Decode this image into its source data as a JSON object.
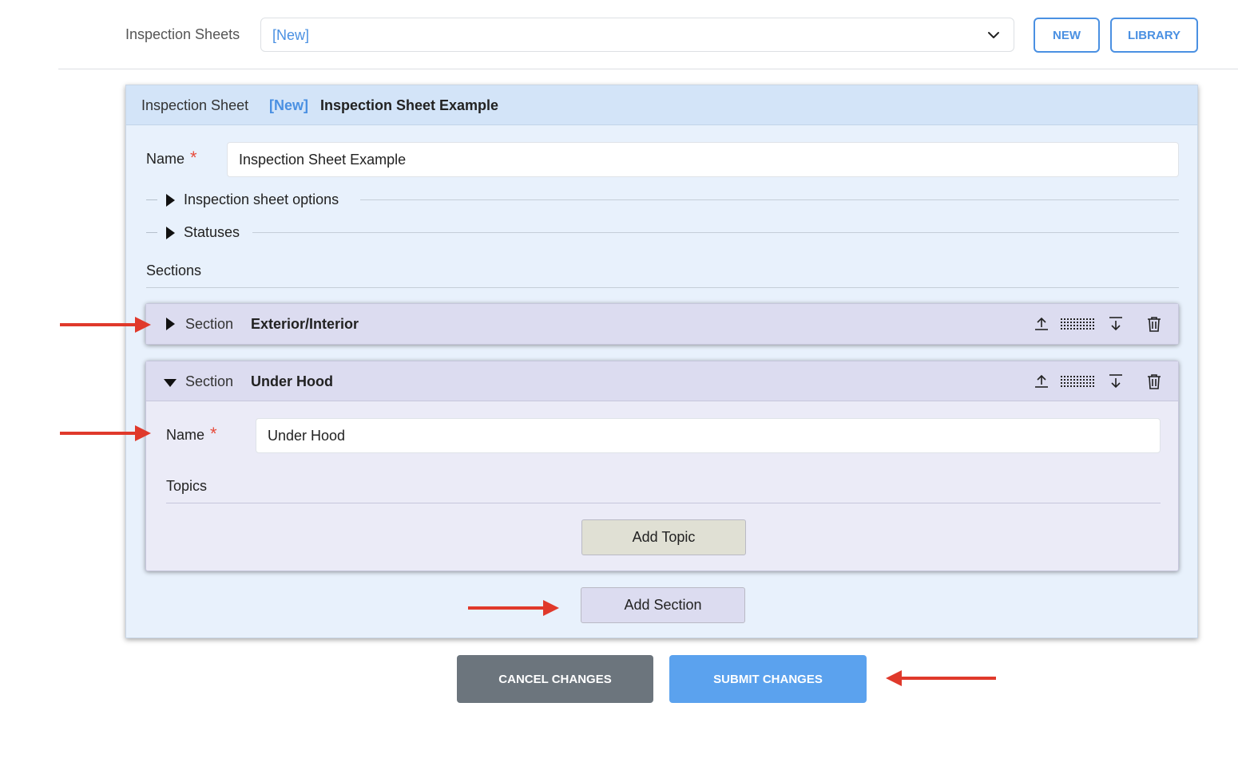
{
  "toolbar": {
    "label": "Inspection Sheets",
    "select_value": "[New]",
    "new_label": "NEW",
    "library_label": "LIBRARY"
  },
  "card": {
    "header_label": "Inspection Sheet",
    "header_status": "[New]",
    "header_name": "Inspection Sheet Example",
    "name_label": "Name",
    "required_mark": "*",
    "name_value": "Inspection Sheet Example",
    "options_label": "Inspection sheet options",
    "statuses_label": "Statuses",
    "sections_label": "Sections"
  },
  "sections": [
    {
      "label": "Section",
      "name": "Exterior/Interior",
      "expanded": false
    },
    {
      "label": "Section",
      "name": "Under Hood",
      "expanded": true,
      "name_label": "Name",
      "name_value": "Under Hood",
      "topics_label": "Topics",
      "add_topic_label": "Add Topic"
    }
  ],
  "add_section_label": "Add Section",
  "actions": {
    "cancel_label": "CANCEL CHANGES",
    "submit_label": "SUBMIT CHANGES"
  },
  "colors": {
    "accent": "#4a90e2",
    "card_bg": "#e8f1fc",
    "section_header_bg": "#dcdcf0",
    "cancel_bg": "#6c757d",
    "submit_bg": "#5ba2ee",
    "annotation_arrow": "#e0392b",
    "add_topic_bg": "#e0e0d4",
    "add_section_bg": "#dcdcf0"
  },
  "icons": {
    "dropdown": "chevron-down-icon",
    "move_up": "move-up-icon",
    "drag": "drag-handle-icon",
    "move_down": "move-down-icon",
    "delete": "trash-icon",
    "collapsed": "caret-right-icon",
    "expanded": "caret-down-icon"
  }
}
